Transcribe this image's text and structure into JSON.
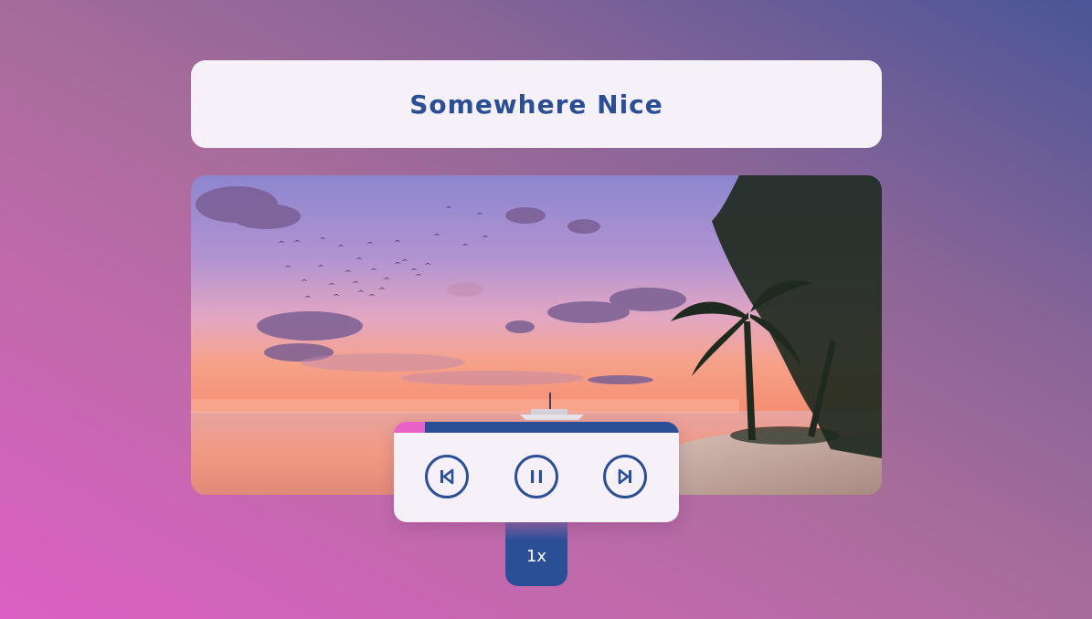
{
  "player": {
    "title": "Somewhere Nice",
    "progress_fraction": 0.11,
    "speed_label": "1x"
  },
  "controls": {
    "prev_icon": "skip-previous-icon",
    "pause_icon": "pause-icon",
    "next_icon": "skip-next-icon"
  },
  "colors": {
    "accent_blue": "#2a4f97",
    "progress_pink": "#e862c8",
    "card_bg": "#f6f1f8"
  }
}
